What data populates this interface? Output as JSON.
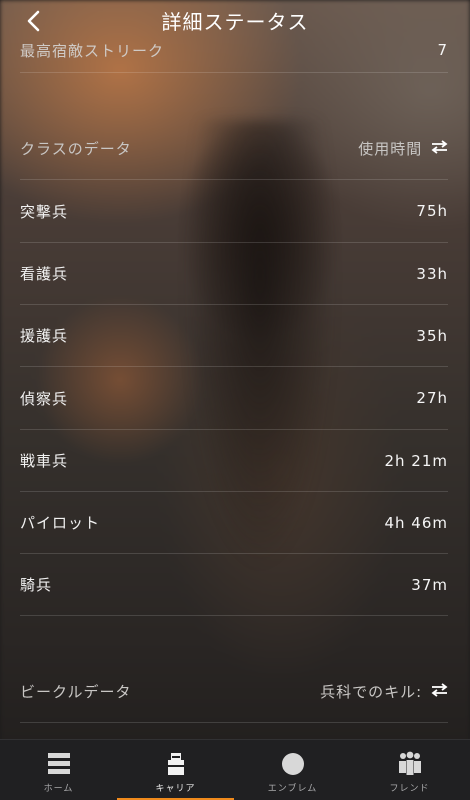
{
  "header": {
    "title": "詳細ステータス"
  },
  "top_row": {
    "label": "最高宿敵ストリーク",
    "value": "7"
  },
  "class_section": {
    "label": "クラスのデータ",
    "sort_label": "使用時間"
  },
  "classes": [
    {
      "label": "突撃兵",
      "value": "75h"
    },
    {
      "label": "看護兵",
      "value": "33h"
    },
    {
      "label": "援護兵",
      "value": "35h"
    },
    {
      "label": "偵察兵",
      "value": "27h"
    },
    {
      "label": "戦車兵",
      "value": "2h 21m"
    },
    {
      "label": "パイロット",
      "value": "4h 46m"
    },
    {
      "label": "騎兵",
      "value": "37m"
    }
  ],
  "vehicle_section": {
    "label": "ビークルデータ",
    "sort_label": "兵科でのキル:"
  },
  "tabs": [
    {
      "label": "ホーム",
      "icon": "home-icon"
    },
    {
      "label": "キャリア",
      "icon": "career-icon"
    },
    {
      "label": "エンブレム",
      "icon": "emblem-icon"
    },
    {
      "label": "フレンド",
      "icon": "friends-icon"
    }
  ],
  "colors": {
    "accent": "#f08a1c",
    "tabbar": "#202022"
  }
}
